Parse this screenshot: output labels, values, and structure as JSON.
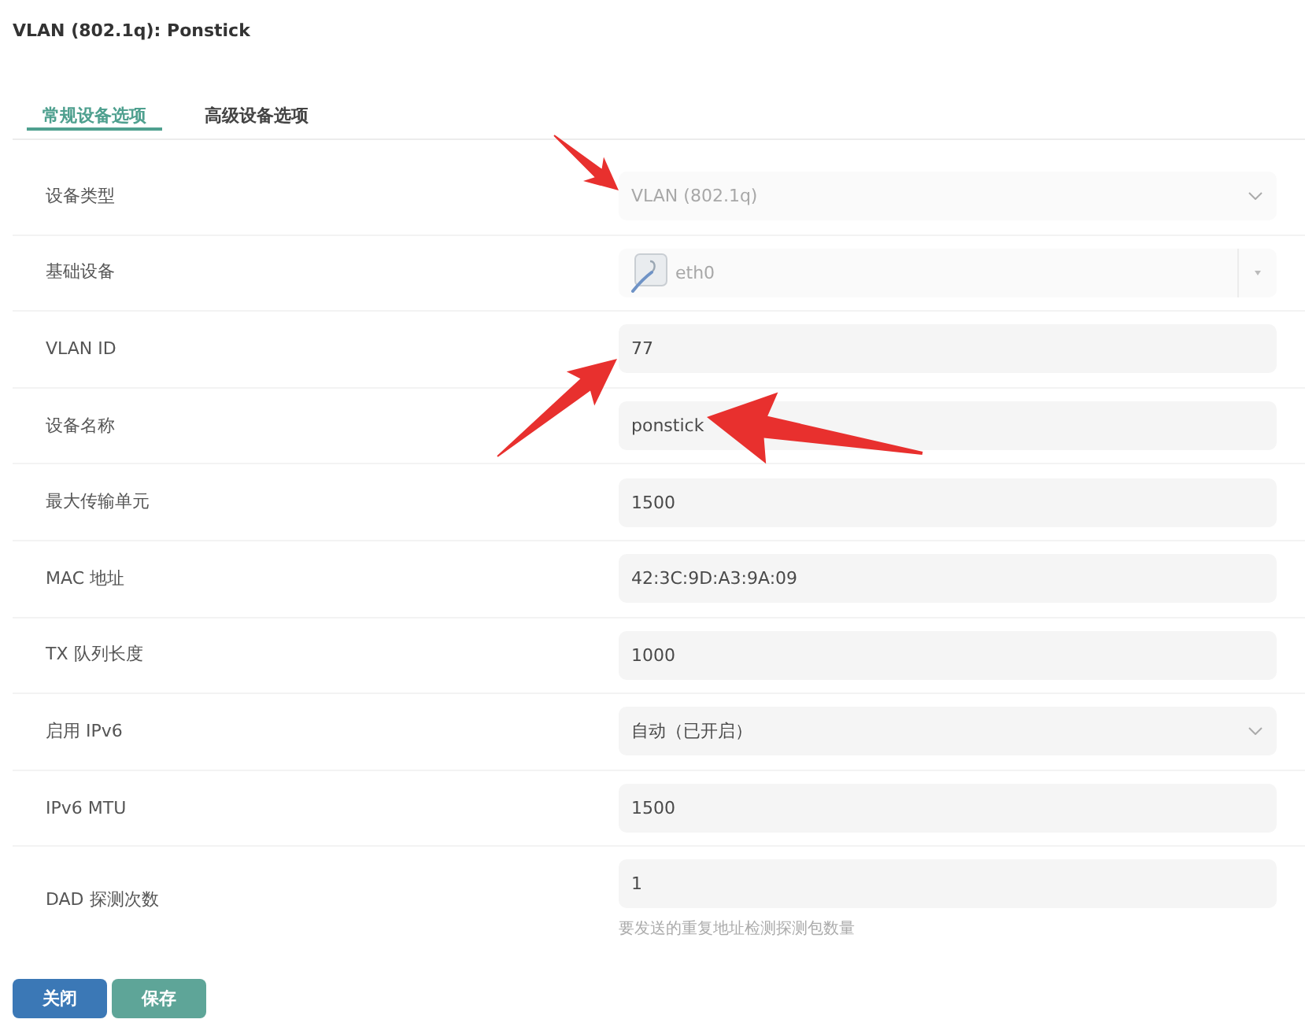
{
  "title": "VLAN (802.1q): Ponstick",
  "tabs": [
    {
      "label": "常规设备选项",
      "selected": true
    },
    {
      "label": "高级设备选项",
      "selected": false
    }
  ],
  "fields": [
    {
      "label": "设备类型",
      "kind": "select",
      "value": "VLAN (802.1q)",
      "disabled": true
    },
    {
      "label": "基础设备",
      "kind": "device-select",
      "value": "eth0",
      "disabled": true
    },
    {
      "label": "VLAN ID",
      "kind": "text",
      "value": "77",
      "disabled": false
    },
    {
      "label": "设备名称",
      "kind": "text",
      "value": "ponstick",
      "disabled": false
    },
    {
      "label": "最大传输单元",
      "kind": "text",
      "value": "1500",
      "disabled": false
    },
    {
      "label": "MAC 地址",
      "kind": "text",
      "value": "42:3C:9D:A3:9A:09",
      "disabled": false
    },
    {
      "label": "TX 队列长度",
      "kind": "text",
      "value": "1000",
      "disabled": false
    },
    {
      "label": "启用 IPv6",
      "kind": "select",
      "value": "自动（已开启）",
      "disabled": false
    },
    {
      "label": "IPv6 MTU",
      "kind": "text",
      "value": "1500",
      "disabled": false
    },
    {
      "label": "DAD 探测次数",
      "kind": "text",
      "value": "1",
      "disabled": false,
      "hint": "要发送的重复地址检测探测包数量"
    }
  ],
  "buttons": [
    {
      "label": "关闭",
      "kind": "close"
    },
    {
      "label": "保存",
      "kind": "save"
    }
  ]
}
